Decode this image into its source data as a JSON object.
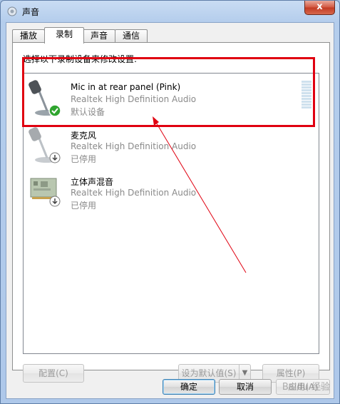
{
  "window": {
    "title": "声音",
    "close_glyph": "x"
  },
  "tabs": [
    {
      "label": "播放"
    },
    {
      "label": "录制"
    },
    {
      "label": "声音"
    },
    {
      "label": "通信"
    }
  ],
  "panel": {
    "instruction": "选择以下录制设备来修改设置:"
  },
  "devices": [
    {
      "name": "Mic in at rear panel (Pink)",
      "driver": "Realtek High Definition Audio",
      "status": "默认设备",
      "icon": "microphone-icon",
      "badge": "green-check-badge"
    },
    {
      "name": "麦克风",
      "driver": "Realtek High Definition Audio",
      "status": "已停用",
      "icon": "microphone-icon",
      "badge": "down-arrow-badge"
    },
    {
      "name": "立体声混音",
      "driver": "Realtek High Definition Audio",
      "status": "已停用",
      "icon": "sound-card-icon",
      "badge": "down-arrow-badge"
    }
  ],
  "buttons": {
    "configure": "配置(C)",
    "set_default": "设为默认值(S)",
    "properties": "属性(P)",
    "ok": "确定",
    "cancel": "取消",
    "apply": "应用(A)"
  },
  "watermark": "Baidu 经验",
  "colors": {
    "annotation": "#e00010",
    "close_button": "#c33a22"
  }
}
